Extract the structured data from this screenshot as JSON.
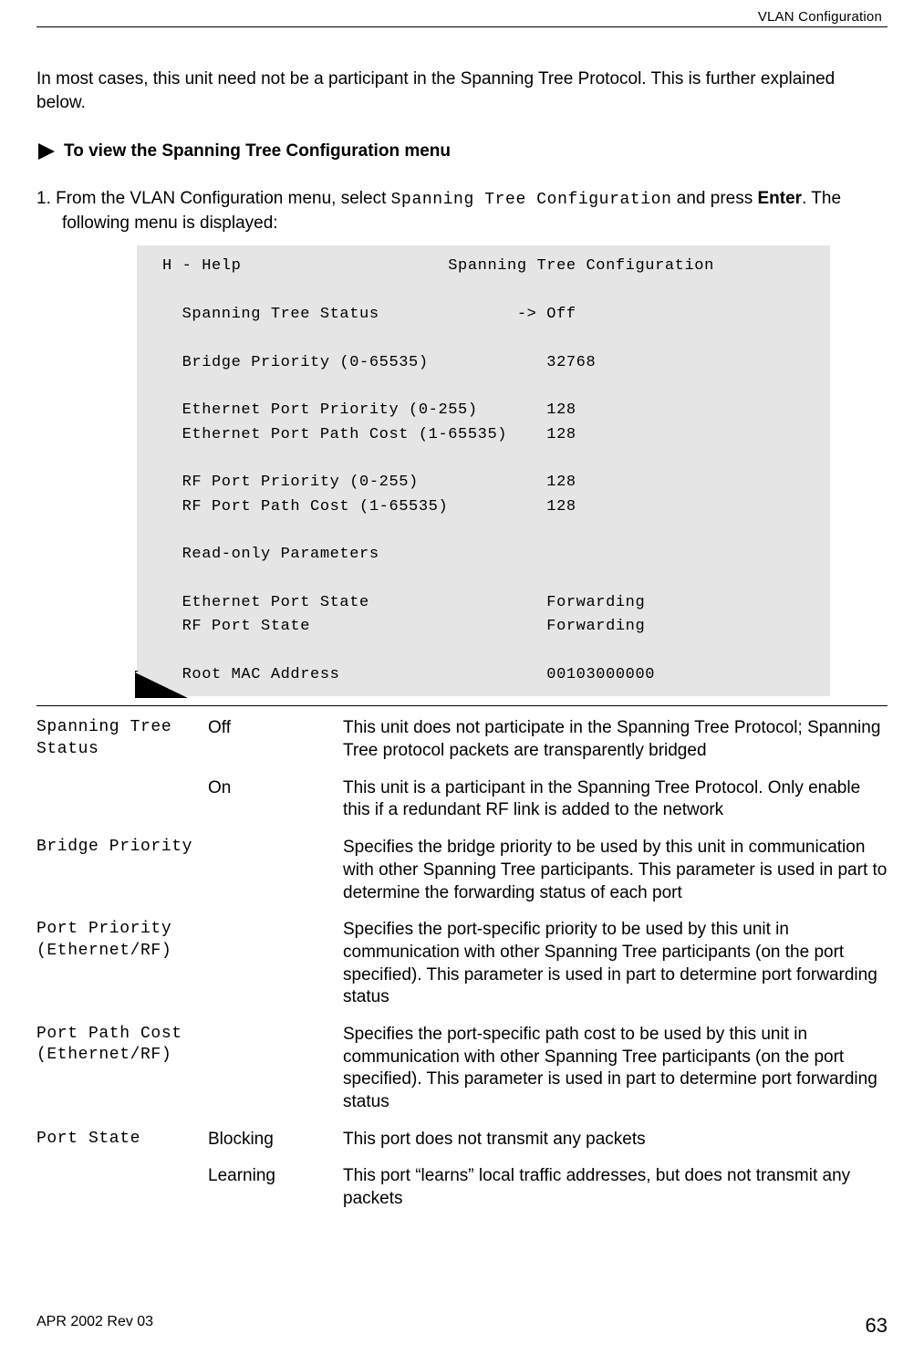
{
  "header": {
    "section": "VLAN Configuration"
  },
  "intro": "In most cases, this unit need not be a participant in the Spanning Tree Protocol.  This is further explained below.",
  "procedure": {
    "title": "To view the Spanning Tree Configuration menu",
    "step_prefix": "1.   ",
    "step_text_a": "From the VLAN Configuration menu, select  ",
    "step_mono": "Spanning Tree Configuration",
    "step_text_b": " and press ",
    "step_bold": "Enter",
    "step_text_c": ". The following menu is displayed:"
  },
  "menu": "H - Help                     Spanning Tree Configuration\n\n  Spanning Tree Status              -> Off\n\n  Bridge Priority (0-65535)            32768\n\n  Ethernet Port Priority (0-255)       128\n  Ethernet Port Path Cost (1-65535)    128\n\n  RF Port Priority (0-255)             128\n  RF Port Path Cost (1-65535)          128\n\n  Read-only Parameters\n\n  Ethernet Port State                  Forwarding\n  RF Port State                        Forwarding\n\n  Root MAC Address                     00103000000",
  "table": {
    "rows": [
      {
        "name": "Spanning Tree Status",
        "val": "Off",
        "desc": "This unit does not participate in the Spanning Tree Protocol; Spanning Tree protocol packets are transparently bridged"
      },
      {
        "name": "",
        "val": "On",
        "desc": "This unit is a participant in the Spanning Tree Protocol. Only enable this if a redundant RF link is added to the network"
      },
      {
        "name": "Bridge Priority",
        "val": "",
        "desc": "Specifies the bridge priority to be used by this unit in communication with other Spanning Tree participants. This parameter is used in part to determine the forwarding status of each port"
      },
      {
        "name": "Port Priority (Ethernet/RF)",
        "val": "",
        "desc": "Specifies the port-specific priority to be used by this unit in communication with other Spanning Tree participants (on the port specified). This parameter is used in part to determine port forwarding status"
      },
      {
        "name": "Port Path Cost (Ethernet/RF)",
        "val": "",
        "desc": "Specifies the port-specific path cost to be used by this unit in communication with other Spanning Tree participants (on the port specified). This parameter is used in part to determine port forwarding status"
      },
      {
        "name": "Port State",
        "val": "Blocking",
        "desc": "This port does not transmit any packets"
      },
      {
        "name": "",
        "val": "Learning",
        "desc": "This port “learns” local traffic addresses, but does not transmit any packets"
      }
    ]
  },
  "footer": {
    "left": "APR 2002 Rev 03",
    "right": "63"
  }
}
